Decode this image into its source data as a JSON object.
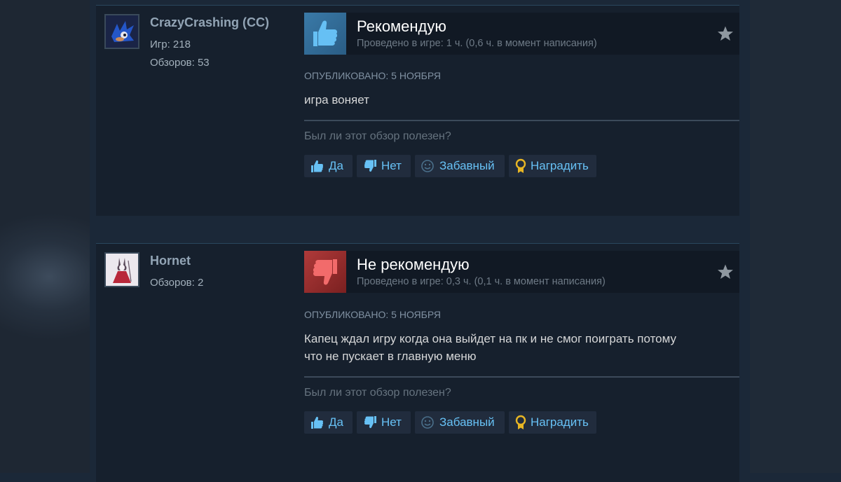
{
  "reviews": [
    {
      "username": "CrazyCrashing (CC)",
      "stats": [
        "Игр: 218",
        "Обзоров: 53"
      ],
      "verdict": "Рекомендую",
      "recommended": true,
      "hours": "Проведено в игре: 1 ч. (0,6 ч. в момент написания)",
      "posted": "ОПУБЛИКОВАНО: 5 НОЯБРЯ",
      "text": "игра воняет",
      "helpful_question": "Был ли этот обзор полезен?",
      "buttons": {
        "yes": "Да",
        "no": "Нет",
        "funny": "Забавный",
        "award": "Наградить"
      }
    },
    {
      "username": "Hornet",
      "stats": [
        "Обзоров: 2"
      ],
      "verdict": "Не рекомендую",
      "recommended": false,
      "hours": "Проведено в игре: 0,3 ч. (0,1 ч. в момент написания)",
      "posted": "ОПУБЛИКОВАНО: 5 НОЯБРЯ",
      "text_lines": [
        "Капец ждал игру когда она выйдет на пк и не смог поиграть потому",
        "что не пускает в главную меню"
      ],
      "helpful_question": "Был ли этот обзор полезен?",
      "buttons": {
        "yes": "Да",
        "no": "Нет",
        "funny": "Забавный",
        "award": "Наградить"
      }
    }
  ],
  "colors": {
    "background": "#1b2838",
    "card": "#16202d",
    "link_blue": "#67c1f5",
    "thumb_up": "#3a7aa8",
    "thumb_down": "#b03a3a",
    "award_gold": "#e8b624"
  },
  "icons": {
    "avatar_1": "sonic-avatar-icon",
    "avatar_2": "hornet-avatar-icon",
    "thumb_up": "thumbs-up-icon",
    "thumb_down": "thumbs-down-icon",
    "star": "star-icon",
    "funny": "smiley-icon",
    "award": "award-medal-icon"
  }
}
